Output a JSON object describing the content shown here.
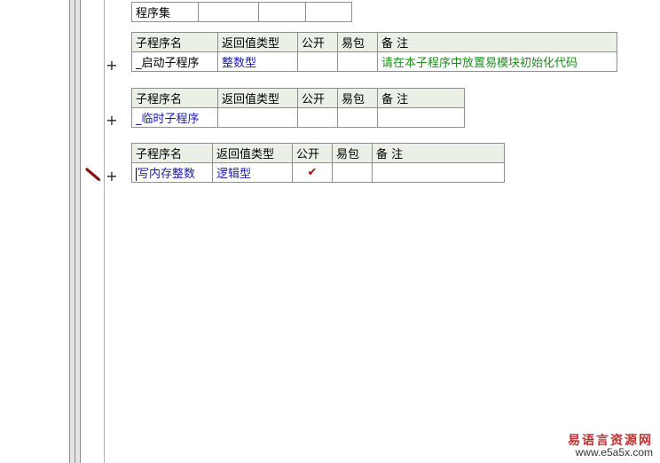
{
  "program_set_table": {
    "label": "程序集"
  },
  "sub_tables": [
    {
      "headers": [
        "子程序名",
        "返回值类型",
        "公开",
        "易包",
        "备 注"
      ],
      "row": {
        "name": "_启动子程序",
        "return_type": "整数型",
        "public": "",
        "pkg": "",
        "remark": "请在本子程序中放置易模块初始化代码"
      }
    },
    {
      "headers": [
        "子程序名",
        "返回值类型",
        "公开",
        "易包",
        "备 注"
      ],
      "row": {
        "name": "_临时子程序",
        "return_type": "",
        "public": "",
        "pkg": "",
        "remark": ""
      }
    },
    {
      "headers": [
        "子程序名",
        "返回值类型",
        "公开",
        "易包",
        "备 注"
      ],
      "row": {
        "name": "写内存整数",
        "return_type": "逻辑型",
        "public": "✔",
        "pkg": "",
        "remark": ""
      }
    }
  ],
  "expand_symbol": "+",
  "watermark": {
    "title": "易语言资源网",
    "url": "www.e5a5x.com"
  },
  "colors": {
    "header_bg": "#eaf0e6",
    "border": "#8e8e8e",
    "type_text": "#1a1ab0",
    "remark_text": "#1f8a1f",
    "check": "#a01010"
  }
}
